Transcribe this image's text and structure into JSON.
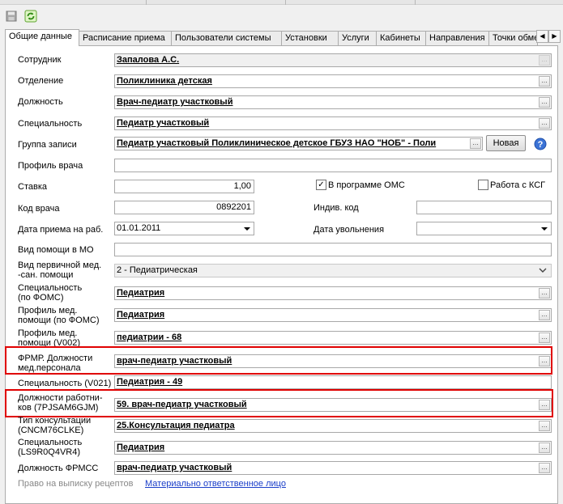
{
  "icons": {
    "save": "save-icon",
    "refresh": "refresh-icon",
    "help": "help-icon"
  },
  "tabs": [
    {
      "label": "Общие данные",
      "active": true
    },
    {
      "label": "Расписание приема"
    },
    {
      "label": "Пользователи системы"
    },
    {
      "label": "Установки"
    },
    {
      "label": "Услуги"
    },
    {
      "label": "Кабинеты"
    },
    {
      "label": "Направления"
    },
    {
      "label": "Точки обме"
    }
  ],
  "form": {
    "employee": {
      "label": "Сотрудник",
      "value": "Запалова А.С."
    },
    "department": {
      "label": "Отделение",
      "value": "Поликлиника детская"
    },
    "position": {
      "label": "Должность",
      "value": "Врач-педиатр участковый"
    },
    "specialty": {
      "label": "Специальность",
      "value": "Педиатр участковый"
    },
    "group": {
      "label": "Группа записи",
      "value": "Педиатр участковый Поликлиническое детское ГБУЗ НАО \"НОБ\" - Поли",
      "new_button": "Новая"
    },
    "profile": {
      "label": "Профиль врача",
      "value": ""
    },
    "rate": {
      "label": "Ставка",
      "value": "1,00"
    },
    "oms": {
      "label": "В программе ОМС",
      "checked": true
    },
    "ksg": {
      "label": "Работа с КСГ",
      "checked": false
    },
    "doctor_code": {
      "label": "Код врача",
      "value": "0892201"
    },
    "indiv_code": {
      "label": "Индив. код",
      "value": ""
    },
    "hire_date": {
      "label": "Дата приема на раб.",
      "value": "01.01.2011"
    },
    "dismiss_date": {
      "label": "Дата увольнения",
      "value": ""
    },
    "help_type": {
      "label": "Вид помощи в МО",
      "value": ""
    },
    "primary_help": {
      "label_1": "Вид первичной мед.",
      "label_2": "-сан. помощи",
      "value": "2 - Педиатрическая"
    },
    "spec_foms": {
      "label_1": "Специальность",
      "label_2": "(по ФОМС)",
      "value": "Педиатрия"
    },
    "profile_foms": {
      "label_1": "Профиль  мед.",
      "label_2": "помощи (по ФОМС)",
      "value": "Педиатрия"
    },
    "profile_v002": {
      "label_1": "Профиль  мед.",
      "label_2": "помощи (V002)",
      "value": "педиатрии - 68"
    },
    "frmr": {
      "label_1": "ФРМР. Должности",
      "label_2": "мед.персонала",
      "value": "врач-педиатр участковый"
    },
    "spec_v021": {
      "label": "Специальность (V021)",
      "value": "Педиатрия - 49"
    },
    "positions_workers": {
      "label_1": "Должности работни-",
      "label_2": "ков (7PJSAM6GJM)",
      "value": "59. врач-педиатр участковый"
    },
    "consult_type": {
      "label_1": "Тип консультации",
      "label_2": "(CNCM76CLKE)",
      "value": "25.Консультация педиатра"
    },
    "spec_ls9": {
      "label_1": "Специальность",
      "label_2": "(LS9R0Q4VR4)",
      "value": "Педиатрия"
    },
    "position_fmss": {
      "label": "Должность ФРМСС",
      "value": "врач-педиатр участковый"
    }
  },
  "footer": {
    "prescription": "Право на выписку рецептов",
    "responsible": "Материально ответственное лицо"
  },
  "colors": {
    "highlight": "#e00000",
    "link": "#1a3ec9"
  }
}
